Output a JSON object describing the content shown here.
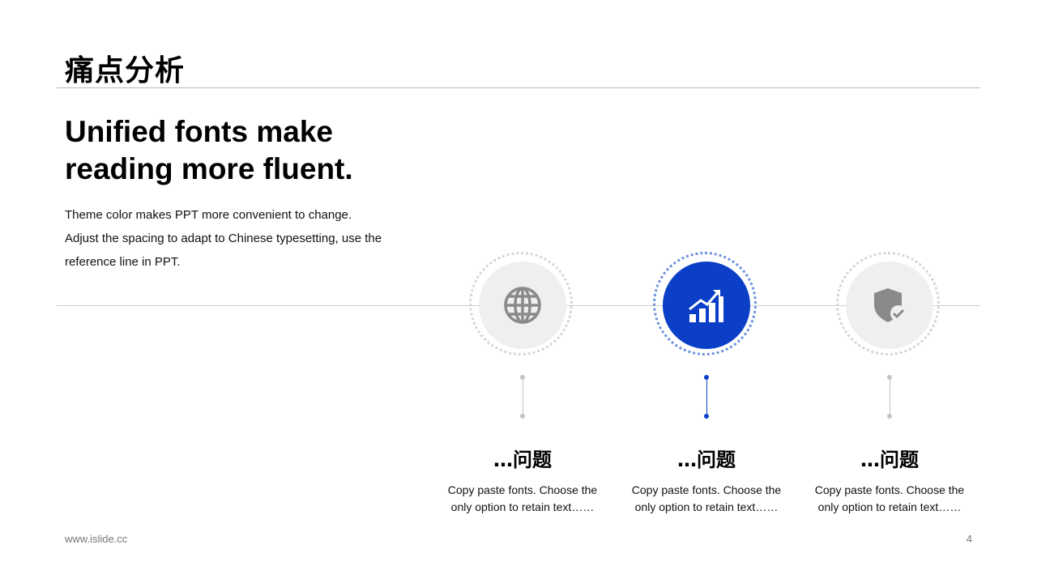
{
  "slide": {
    "title": "痛点分析",
    "headline": "Unified fonts make reading more fluent.",
    "body_lines": [
      "Theme color makes PPT more convenient to change.",
      "Adjust the spacing to adapt to Chinese typesetting, use the",
      "reference line in PPT."
    ]
  },
  "features": [
    {
      "icon": "globe-icon",
      "title": "…问题",
      "desc_lines": [
        "Copy paste fonts. Choose the",
        "only option to retain text……"
      ],
      "active": false
    },
    {
      "icon": "growth-chart-icon",
      "title": "…问题",
      "desc_lines": [
        "Copy paste fonts. Choose the",
        "only option to retain text……"
      ],
      "active": true
    },
    {
      "icon": "shield-check-icon",
      "title": "…问题",
      "desc_lines": [
        "Copy paste fonts. Choose the",
        "only option to retain text……"
      ],
      "active": false
    }
  ],
  "colors": {
    "accent": "#0b3fc7",
    "icon_gray": "#8a8a8a"
  },
  "footer": {
    "url": "www.islide.cc",
    "page_number": "4"
  }
}
